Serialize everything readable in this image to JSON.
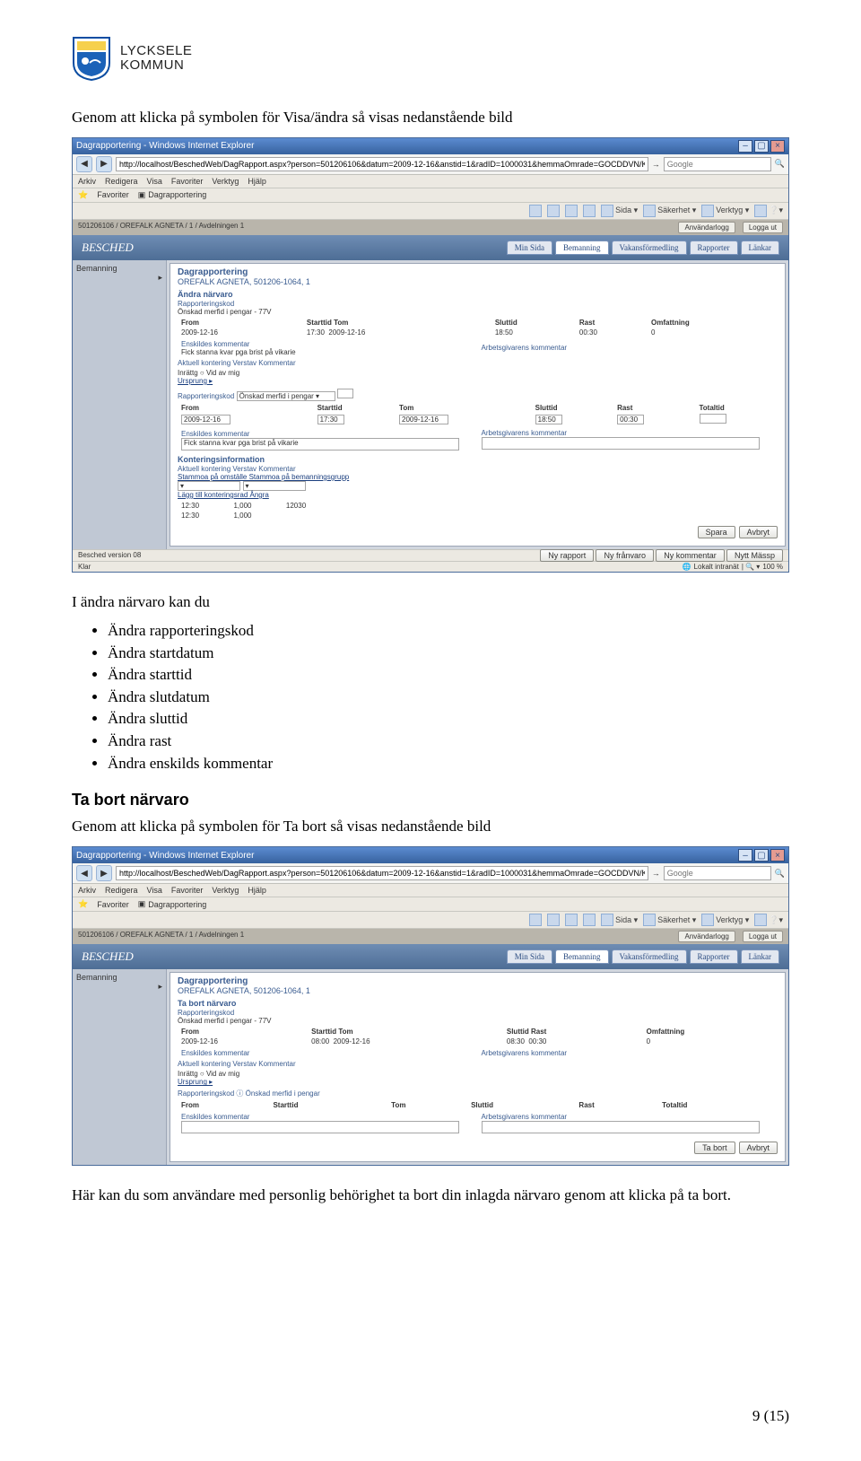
{
  "logo": {
    "line1": "LYCKSELE",
    "line2": "KOMMUN"
  },
  "intro1": "Genom att klicka på symbolen för Visa/ändra så visas nedanstående bild",
  "intro2": "I ändra närvaro kan du",
  "bullets1": [
    "Ändra rapporteringskod",
    "Ändra startdatum",
    "Ändra starttid",
    "Ändra slutdatum",
    "Ändra sluttid",
    "Ändra rast",
    "Ändra enskilds kommentar"
  ],
  "section2_title": "Ta bort närvaro",
  "section2_intro": "Genom att klicka på symbolen för Ta bort så visas nedanstående bild",
  "section2_outro": "Här kan du som användare med personlig behörighet ta bort din inlagda närvaro genom att klicka på ta bort.",
  "page_counter": "9 (15)",
  "browser": {
    "title": "Dagrapportering - Windows Internet Explorer",
    "url_prefix": "http://localhost/BeschedWeb/DagRapport.aspx?person=501206106&datum=2009-12-16&anstid=1&radID=1000031&hemmaOmrade=GOCDDVN/KOPING&hemmaO",
    "menus": [
      "Arkiv",
      "Redigera",
      "Visa",
      "Favoriter",
      "Verktyg",
      "Hjälp"
    ],
    "fav_label": "Favoriter",
    "tab_label": "Dagrapportering",
    "cmds": [
      "",
      "",
      "",
      "",
      "Sida ▾",
      "Säkerhet ▾",
      "Verktyg ▾",
      "❔▾"
    ],
    "crumb": "501206106 / OREFALK AGNETA / 1 / Avdelningen 1",
    "chips": [
      "Användarlogg",
      "Logga ut"
    ],
    "brand": "BESCHED",
    "app_tabs": [
      "Min Sida",
      "Bemanning",
      "Vakansförmedling",
      "Rapporter",
      "Länkar"
    ],
    "left_item": "Bemanning",
    "main_title": "Dagrapportering",
    "main_sub": "OREFALK AGNETA, 501206-1064, 1",
    "status_done": "Klar",
    "intranet": "Lokalt intranät",
    "zoom": "100 %"
  },
  "screen1": {
    "panel_title": "Ändra närvaro",
    "rpt_label": "Rapporteringskod",
    "rpt_value": "Önskad merfid i pengar - 77V",
    "cols": [
      "From",
      "Starttid  Tom",
      "Sluttid",
      "Rast",
      "Omfattning"
    ],
    "row_read": [
      "2009-12-16",
      "17:30",
      "2009-12-16",
      "18:50",
      "00:30",
      "0"
    ],
    "ens_head": "Enskildes kommentar",
    "ag_head": "Arbetsgivarens kommentar",
    "ens_val": "Fick stanna kvar pga brist på vikarie",
    "kont_row": "Aktuell kontering   Verstav   Kommentar",
    "radio": "Inrättg ○ Vid av mig",
    "ursprung": "Ursprung ▸",
    "rpt_sel_label": "Rapporteringskod",
    "rpt_sel_value": "Önskad merfid i pengar ▾",
    "row_edit_cols": [
      "From",
      "Starttid",
      "Tom",
      "Sluttid",
      "Rast",
      "Totaltid"
    ],
    "row_edit": [
      "2009-12-16",
      "17:30",
      "2009-12-16",
      "18:50",
      "00:30",
      ""
    ],
    "ens_val2": "Fick stanna kvar pga brist på vikarie",
    "kont_head": "Konteringsinformation",
    "kont_sub": "Aktuell kontering  Verstav  Kommentar",
    "stam_link": "Stammoa på omställe  Stammoa på bemanningsgrupp",
    "sel_boxes": [
      "▾",
      "▾"
    ],
    "bottom_action": "Lägg till konteringsrad   Ångra",
    "bottom_rows": [
      [
        "12:30",
        "1,000",
        "12030"
      ],
      [
        "12:30",
        "1,000",
        ""
      ]
    ],
    "save": "Spara",
    "cancel": "Avbryt",
    "status_left": "Besched version 08",
    "status_cmds": [
      "Ny rapport",
      "Ny frånvaro",
      "Ny kommentar",
      "Nytt Mässp"
    ]
  },
  "screen2": {
    "panel_title": "Ta bort närvaro",
    "rpt_label": "Rapporteringskod",
    "rpt_value": "Önskad merfid i pengar - 77V",
    "cols": [
      "From",
      "Starttid  Tom",
      "Sluttid  Rast",
      "Omfattning"
    ],
    "row": [
      "2009-12-16",
      "08:00",
      "2009-12-16",
      "08:30",
      "00:30",
      "0"
    ],
    "ens_head": "Enskildes kommentar",
    "ag_head": "Arbetsgivarens kommentar",
    "kont_row": "Aktuell kontering   Verstav   Kommentar",
    "radio": "Inrättg ○ Vid av mig",
    "ursprung": "Ursprung ▸",
    "rpt_sel_label": "Rapporteringskod ⓘ Önskad merfid i pengar",
    "row_edit_cols": [
      "From",
      "Starttid",
      "Tom",
      "Sluttid",
      "Rast",
      "Totaltid"
    ],
    "ens_head2": "Enskildes kommentar",
    "ag_head2": "Arbetsgivarens kommentar",
    "delete": "Ta bort",
    "cancel": "Avbryt"
  }
}
